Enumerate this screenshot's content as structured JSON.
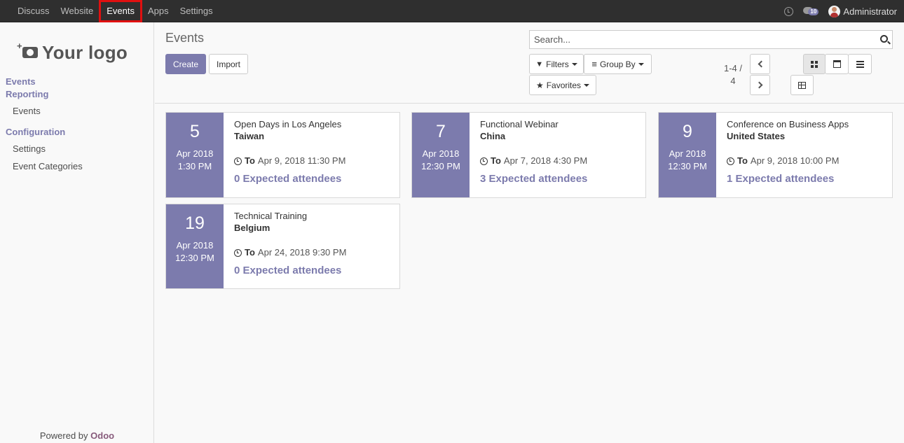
{
  "topbar": {
    "menu": [
      "Discuss",
      "Website",
      "Events",
      "Apps",
      "Settings"
    ],
    "active_menu": "Events",
    "message_count": "10",
    "user_name": "Administrator"
  },
  "sidebar": {
    "logo_text": "Your logo",
    "sections": [
      {
        "label": "Events",
        "items": []
      },
      {
        "label": "Reporting",
        "items": [
          "Events"
        ]
      },
      {
        "label": "Configuration",
        "items": [
          "Settings",
          "Event Categories"
        ]
      }
    ],
    "powered_by": "Powered by",
    "powered_brand": "Odoo"
  },
  "control_panel": {
    "title": "Events",
    "create_label": "Create",
    "import_label": "Import",
    "search_placeholder": "Search...",
    "filters_label": "Filters",
    "group_by_label": "Group By",
    "favorites_label": "Favorites",
    "pager_line1": "1-4 /",
    "pager_line2": "4"
  },
  "events": [
    {
      "day": "5",
      "month_year": "Apr 2018",
      "time": "1:30 PM",
      "name": "Open Days in Los Angeles",
      "country": "Taiwan",
      "to_label": "To",
      "end": "Apr 9, 2018 11:30 PM",
      "attendees": "0 Expected attendees"
    },
    {
      "day": "7",
      "month_year": "Apr 2018",
      "time": "12:30 PM",
      "name": "Functional Webinar",
      "country": "China",
      "to_label": "To",
      "end": "Apr 7, 2018 4:30 PM",
      "attendees": "3 Expected attendees"
    },
    {
      "day": "9",
      "month_year": "Apr 2018",
      "time": "12:30 PM",
      "name": "Conference on Business Apps",
      "country": "United States",
      "to_label": "To",
      "end": "Apr 9, 2018 10:00 PM",
      "attendees": "1 Expected attendees"
    },
    {
      "day": "19",
      "month_year": "Apr 2018",
      "time": "12:30 PM",
      "name": "Technical Training",
      "country": "Belgium",
      "to_label": "To",
      "end": "Apr 24, 2018 9:30 PM",
      "attendees": "0 Expected attendees"
    }
  ],
  "colors": {
    "accent": "#7c7bad",
    "topbar": "#2f2f2f",
    "highlight": "#e01010"
  },
  "icons": [
    "clock-icon",
    "chat-icon",
    "camera-icon",
    "search-icon",
    "filter-icon",
    "group-by-icon",
    "star-icon",
    "chevron-left-icon",
    "chevron-right-icon",
    "kanban-view-icon",
    "calendar-view-icon",
    "list-view-icon",
    "pivot-view-icon"
  ]
}
